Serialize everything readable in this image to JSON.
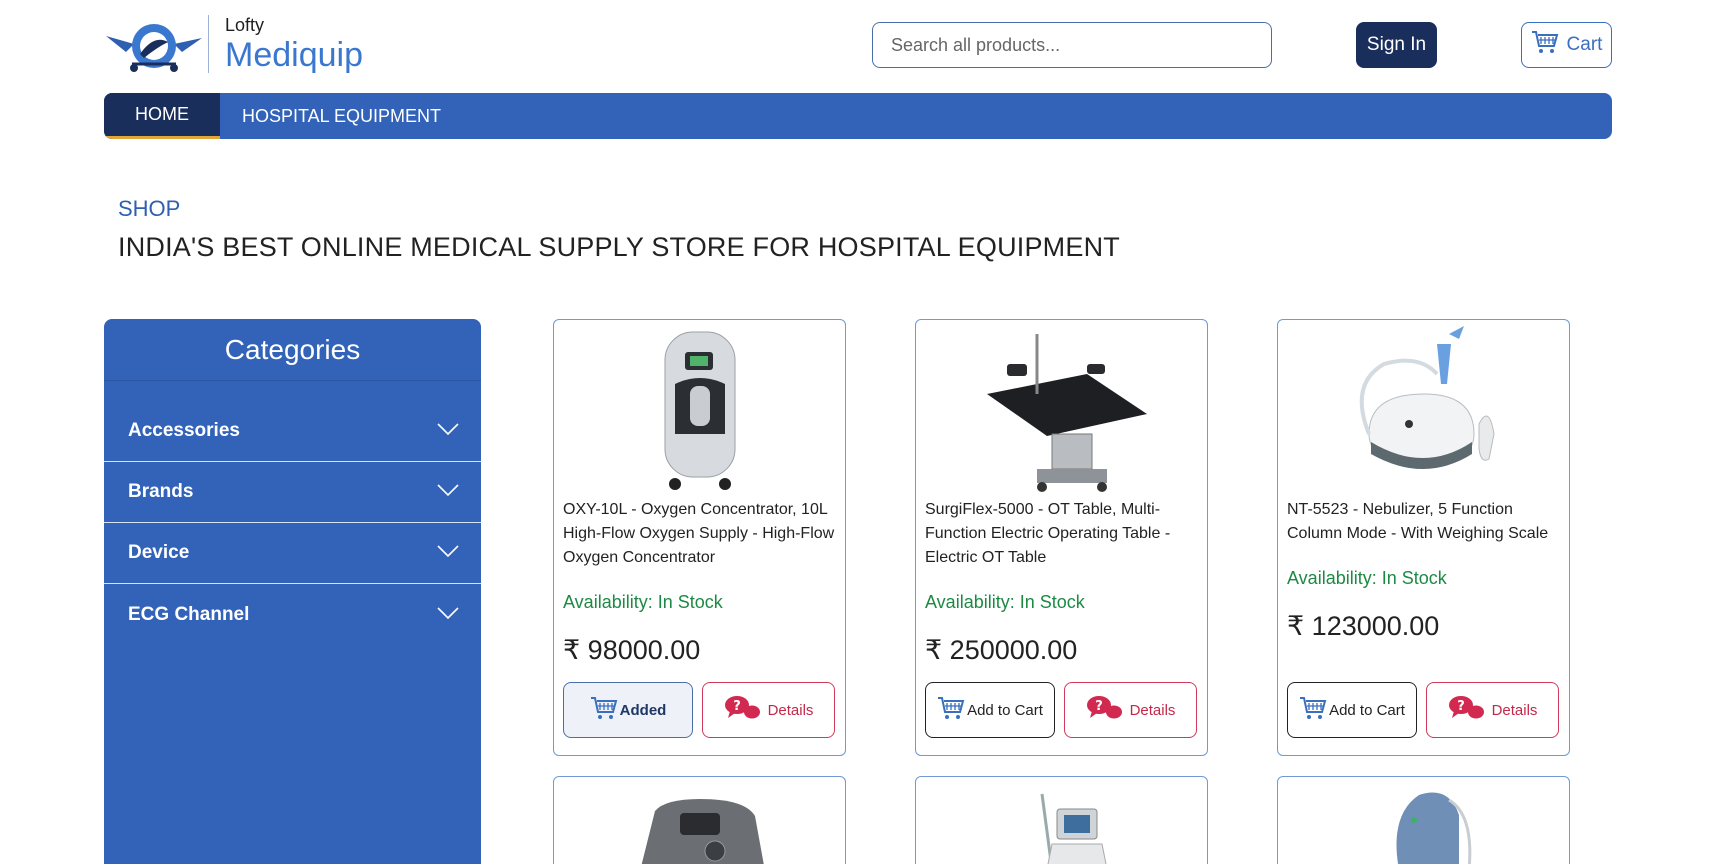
{
  "header": {
    "logo_small": "Lofty",
    "logo_big": "Mediquip",
    "search_placeholder": "Search all products...",
    "signin_label": "Sign In",
    "cart_label": "Cart"
  },
  "nav": {
    "items": [
      {
        "label": "HOME",
        "active": true
      },
      {
        "label": "HOSPITAL EQUIPMENT",
        "active": false
      }
    ]
  },
  "hero": {
    "shop_label": "SHOP",
    "title": "INDIA'S BEST ONLINE MEDICAL SUPPLY STORE FOR HOSPITAL EQUIPMENT"
  },
  "sidebar": {
    "title": "Categories",
    "categories": [
      {
        "label": "Accessories"
      },
      {
        "label": "Brands"
      },
      {
        "label": "Device"
      },
      {
        "label": "ECG Channel"
      }
    ]
  },
  "products": [
    {
      "name": "OXY-10L - Oxygen Concentrator, 10L High-Flow Oxygen Supply - High-Flow Oxygen Concentrator",
      "availability": "Availability: In Stock",
      "price": "₹ 98000.00",
      "cart_label": "Added",
      "details_label": "Details"
    },
    {
      "name": "SurgiFlex-5000 - OT Table, Multi-Function Electric Operating Table - Electric OT Table",
      "availability": "Availability: In Stock",
      "price": "₹ 250000.00",
      "cart_label": "Add to Cart",
      "details_label": "Details"
    },
    {
      "name": "NT-5523 - Nebulizer, 5 Function Column Mode - With Weighing Scale",
      "availability": "Availability: In Stock",
      "price": "₹ 123000.00",
      "cart_label": "Add to Cart",
      "details_label": "Details"
    }
  ],
  "icons": {
    "cart": "cart-icon",
    "chevron": "chevron-down-icon",
    "details": "chat-question-icon"
  },
  "colors": {
    "primary": "#3263b8",
    "dark": "#1a2e5c",
    "accent": "#e0a63a",
    "stock": "#1d8a44",
    "details": "#c3284a"
  }
}
